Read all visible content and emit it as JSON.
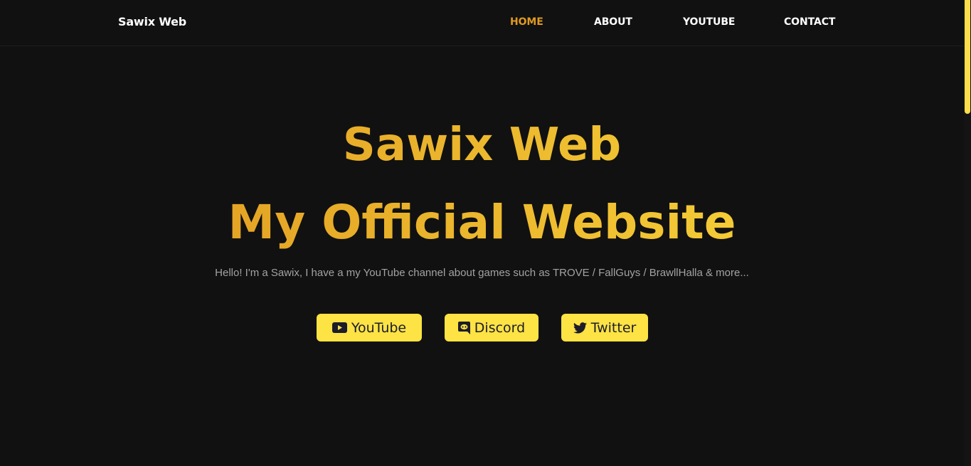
{
  "header": {
    "logo": "Sawix Web",
    "nav": [
      {
        "label": "HOME",
        "active": true
      },
      {
        "label": "ABOUT",
        "active": false
      },
      {
        "label": "YOUTUBE",
        "active": false
      },
      {
        "label": "CONTACT",
        "active": false
      }
    ]
  },
  "hero": {
    "title_line1": "Sawix Web",
    "title_line2": "My Official Website",
    "subtitle": "Hello! I'm a Sawix, I have a my YouTube channel about games such as TROVE / FallGuys / BrawllHalla & more...",
    "buttons": [
      {
        "label": "YouTube",
        "icon": "youtube-icon"
      },
      {
        "label": "Discord",
        "icon": "discord-icon"
      },
      {
        "label": "Twitter",
        "icon": "twitter-icon"
      }
    ]
  },
  "colors": {
    "background": "#111111",
    "accent": "#e09a21",
    "gradient_start": "#dd931e",
    "gradient_end": "#fbdc3d",
    "button_bg": "#fde344",
    "scroll_thumb": "#fdde4a"
  }
}
